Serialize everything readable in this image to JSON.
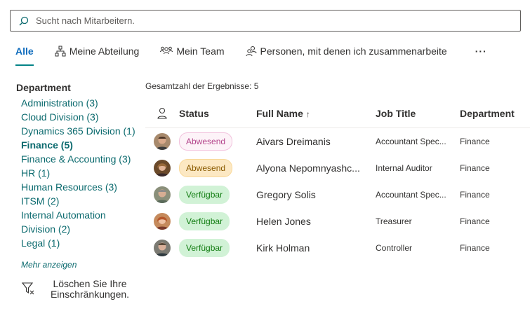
{
  "search": {
    "placeholder": "Sucht nach Mitarbeitern."
  },
  "tabs": [
    {
      "label": "Alle",
      "active": true
    },
    {
      "label": "Meine Abteilung",
      "icon": "org-chart-icon"
    },
    {
      "label": "Mein Team",
      "icon": "people-team-icon"
    },
    {
      "label": "Personen, mit denen ich zusammenarbeite",
      "icon": "people-icon"
    },
    {
      "label": "···",
      "icon": "more-icon"
    }
  ],
  "filter": {
    "title": "Department",
    "facets": [
      "Administration (3)",
      "Cloud Division (3)",
      "Dynamics 365 Division (1)",
      "Finance (5)",
      "Finance & Accounting (3)",
      "HR (1)",
      "Human Resources (3)",
      "ITSM (2)",
      "Internal Automation Division (2)",
      "Legal (1)"
    ],
    "more": "Mehr anzeigen",
    "clear": "Löschen Sie Ihre Einschränkungen."
  },
  "results": {
    "total": "Gesamtzahl der Ergebnisse: 5",
    "columns": {
      "status": "Status",
      "name": "Full Name",
      "sort": "↑",
      "title": "Job Title",
      "dept": "Department"
    },
    "rows": [
      {
        "status": "Abwesend",
        "name": "Aivars Dreimanis",
        "title": "Accountant Spec...",
        "dept": "Finance"
      },
      {
        "status": "Abwesend",
        "name": "Alyona Nepomnyashc...",
        "title": "Internal Auditor",
        "dept": "Finance"
      },
      {
        "status": "Verfügbar",
        "name": "Gregory Solis",
        "title": "Accountant Spec...",
        "dept": "Finance"
      },
      {
        "status": "Verfügbar",
        "name": "Helen Jones",
        "title": "Treasurer",
        "dept": "Finance"
      },
      {
        "status": "Verfügbar",
        "name": "Kirk Holman",
        "title": "Controller",
        "dept": "Finance"
      }
    ]
  },
  "colors": {
    "accent": "#038387",
    "link": "#0b6a6e",
    "available": "#107c10",
    "away": "#b4468c"
  }
}
